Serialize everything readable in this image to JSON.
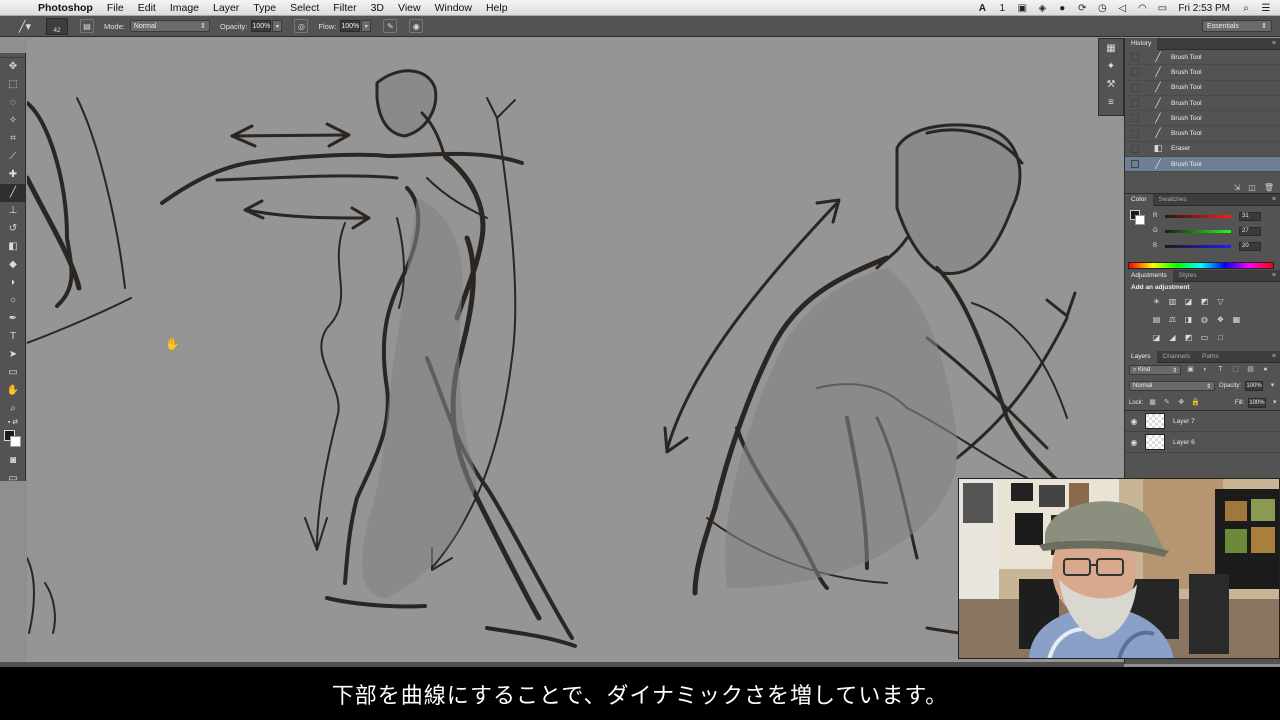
{
  "menubar": {
    "app_name": "Photoshop",
    "items": [
      "File",
      "Edit",
      "Image",
      "Layer",
      "Type",
      "Select",
      "Filter",
      "3D",
      "View",
      "Window",
      "Help"
    ],
    "status": {
      "ai": "A",
      "display": "1",
      "clock": "Fri 2:53 PM"
    }
  },
  "options": {
    "brush_size": "42",
    "mode_label": "Mode:",
    "mode_value": "Normal",
    "opacity_label": "Opacity:",
    "opacity_value": "100%",
    "flow_label": "Flow:",
    "flow_value": "100%",
    "workspace": "Essentials"
  },
  "history": {
    "title": "History",
    "items": [
      {
        "label": "Brush Tool",
        "icon": "brush-icon"
      },
      {
        "label": "Brush Tool",
        "icon": "brush-icon"
      },
      {
        "label": "Brush Tool",
        "icon": "brush-icon"
      },
      {
        "label": "Brush Tool",
        "icon": "brush-icon"
      },
      {
        "label": "Brush Tool",
        "icon": "brush-icon"
      },
      {
        "label": "Brush Tool",
        "icon": "brush-icon"
      },
      {
        "label": "Eraser",
        "icon": "eraser-icon"
      },
      {
        "label": "Brush Tool",
        "icon": "brush-icon"
      }
    ],
    "selected_index": 7
  },
  "color": {
    "tabs": [
      "Color",
      "Swatches"
    ],
    "r_label": "R",
    "g_label": "G",
    "b_label": "B",
    "r": "31",
    "g": "27",
    "b": "20",
    "foreground": "#1f1b14",
    "background": "#ffffff"
  },
  "adjustments": {
    "tabs": [
      "Adjustments",
      "Styles"
    ],
    "title": "Add an adjustment"
  },
  "layers": {
    "tabs": [
      "Layers",
      "Channels",
      "Paths"
    ],
    "filter_label": "Kind",
    "blend_mode": "Normal",
    "opacity_label": "Opacity:",
    "opacity_value": "100%",
    "lock_label": "Lock:",
    "fill_label": "Fill:",
    "fill_value": "100%",
    "items": [
      "Layer 7",
      "Layer 6"
    ]
  },
  "subtitle": "下部を曲線にすることで、ダイナミックさを増しています。",
  "accent_colors": {
    "panel": "#535353",
    "canvas": "#959595",
    "selection": "#6e7f94"
  }
}
